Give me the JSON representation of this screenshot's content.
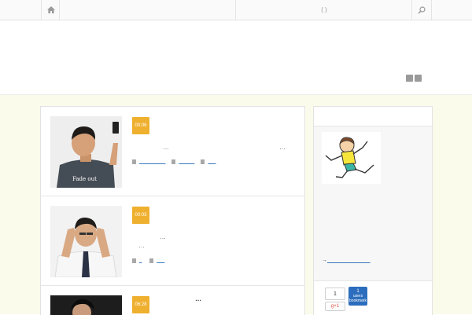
{
  "nav": {
    "mid_label": "(  )"
  },
  "posts": [
    {
      "date": "00:06",
      "excerpt_a": "…",
      "excerpt_b": "…",
      "category": "___ ___ ___",
      "tag": "______",
      "comments": "___"
    },
    {
      "date": "00:03",
      "excerpt_a": "…",
      "excerpt_b": "…",
      "category": "_",
      "comments": "___"
    },
    {
      "date": "06:28",
      "title_fragment": "…"
    }
  ],
  "sidebar": {
    "arrow": "→",
    "link_text": "______________"
  },
  "share": {
    "count": "1",
    "gplus": "g+1",
    "hatena_count": "1",
    "hatena_users": "users",
    "hatena_label": "bookmark"
  },
  "colors": {
    "accent": "#efb02f",
    "link": "#3b7bbf",
    "content_bg": "#fbfbec"
  }
}
